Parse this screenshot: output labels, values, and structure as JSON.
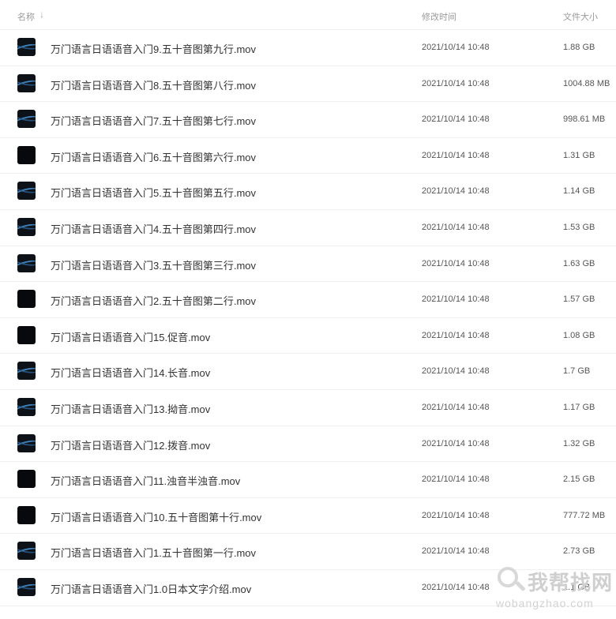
{
  "header": {
    "name_label": "名称",
    "sort_indicator": "↓",
    "time_label": "修改时间",
    "size_label": "文件大小"
  },
  "files": [
    {
      "name": "万门语言日语语音入门9.五十音图第九行.mov",
      "modified": "2021/10/14 10:48",
      "size": "1.88 GB",
      "thumb": "wave"
    },
    {
      "name": "万门语言日语语音入门8.五十音图第八行.mov",
      "modified": "2021/10/14 10:48",
      "size": "1004.88 MB",
      "thumb": "wave"
    },
    {
      "name": "万门语言日语语音入门7.五十音图第七行.mov",
      "modified": "2021/10/14 10:48",
      "size": "998.61 MB",
      "thumb": "wave"
    },
    {
      "name": "万门语言日语语音入门6.五十音图第六行.mov",
      "modified": "2021/10/14 10:48",
      "size": "1.31 GB",
      "thumb": "dark"
    },
    {
      "name": "万门语言日语语音入门5.五十音图第五行.mov",
      "modified": "2021/10/14 10:48",
      "size": "1.14 GB",
      "thumb": "wave"
    },
    {
      "name": "万门语言日语语音入门4.五十音图第四行.mov",
      "modified": "2021/10/14 10:48",
      "size": "1.53 GB",
      "thumb": "wave"
    },
    {
      "name": "万门语言日语语音入门3.五十音图第三行.mov",
      "modified": "2021/10/14 10:48",
      "size": "1.63 GB",
      "thumb": "wave"
    },
    {
      "name": "万门语言日语语音入门2.五十音图第二行.mov",
      "modified": "2021/10/14 10:48",
      "size": "1.57 GB",
      "thumb": "dark"
    },
    {
      "name": "万门语言日语语音入门15.促音.mov",
      "modified": "2021/10/14 10:48",
      "size": "1.08 GB",
      "thumb": "dark"
    },
    {
      "name": "万门语言日语语音入门14.长音.mov",
      "modified": "2021/10/14 10:48",
      "size": "1.7 GB",
      "thumb": "wave"
    },
    {
      "name": "万门语言日语语音入门13.拗音.mov",
      "modified": "2021/10/14 10:48",
      "size": "1.17 GB",
      "thumb": "wave"
    },
    {
      "name": "万门语言日语语音入门12.拨音.mov",
      "modified": "2021/10/14 10:48",
      "size": "1.32 GB",
      "thumb": "wave"
    },
    {
      "name": "万门语言日语语音入门11.浊音半浊音.mov",
      "modified": "2021/10/14 10:48",
      "size": "2.15 GB",
      "thumb": "dark"
    },
    {
      "name": "万门语言日语语音入门10.五十音图第十行.mov",
      "modified": "2021/10/14 10:48",
      "size": "777.72 MB",
      "thumb": "dark"
    },
    {
      "name": "万门语言日语语音入门1.五十音图第一行.mov",
      "modified": "2021/10/14 10:48",
      "size": "2.73 GB",
      "thumb": "wave"
    },
    {
      "name": "万门语言日语语音入门1.0日本文字介绍.mov",
      "modified": "2021/10/14 10:48",
      "size": "1.1 GB",
      "thumb": "wave"
    }
  ],
  "watermark": {
    "cn": "我帮找网",
    "en": "wobangzhao.com"
  }
}
